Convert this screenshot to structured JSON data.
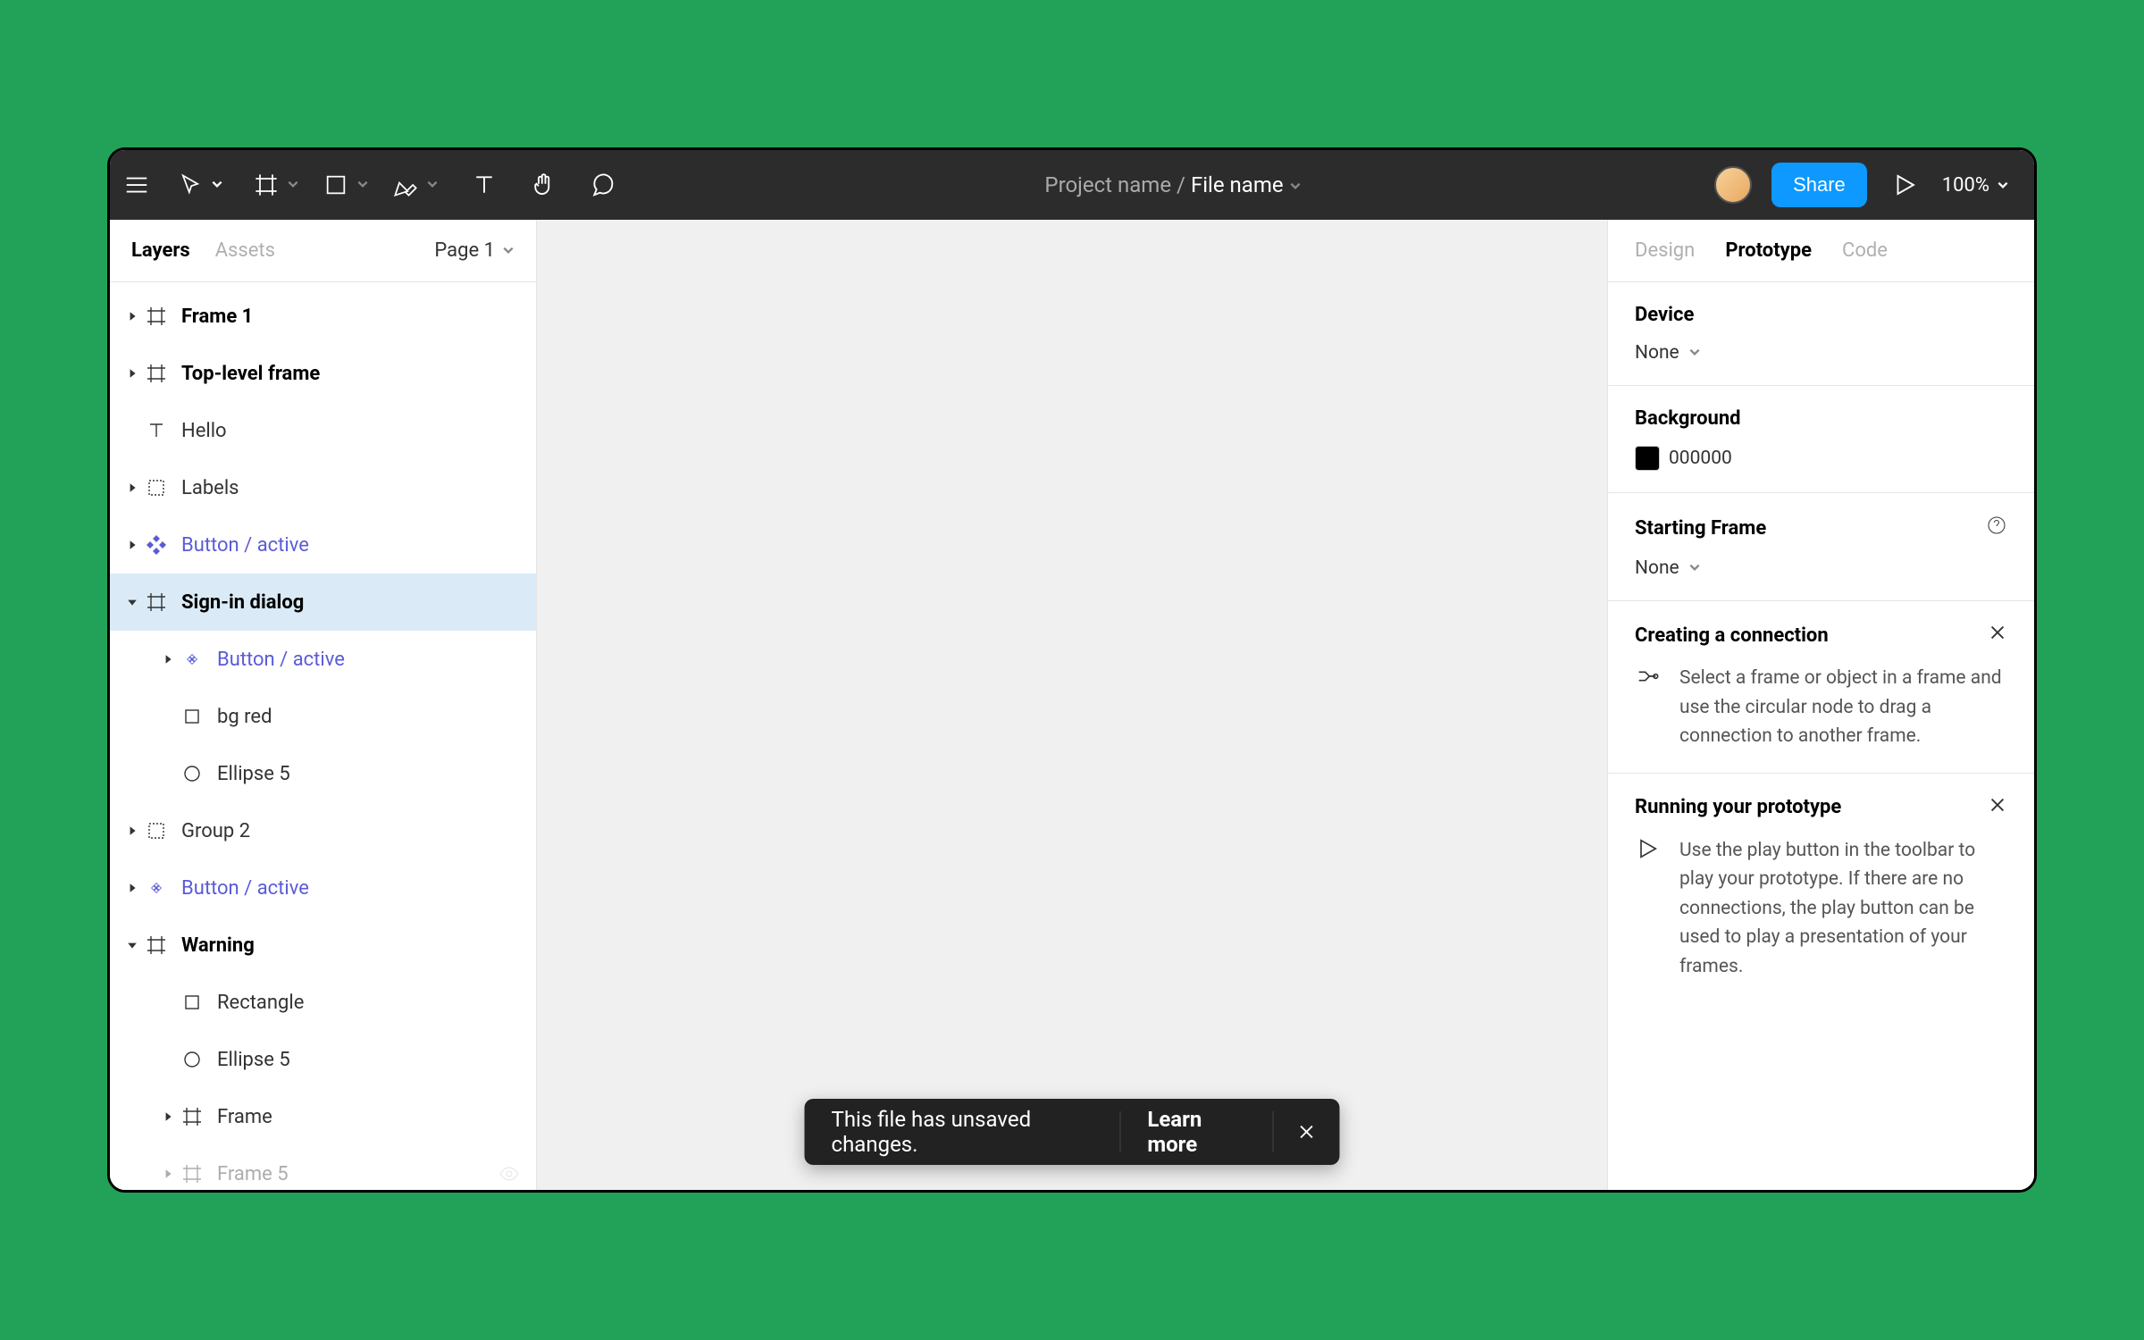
{
  "toolbar": {
    "project_name": "Project name",
    "file_name": "File name",
    "share_label": "Share",
    "zoom": "100%"
  },
  "left_panel": {
    "tabs": {
      "layers": "Layers",
      "assets": "Assets"
    },
    "page": "Page 1",
    "layers": [
      {
        "label": "Frame 1",
        "icon": "frame",
        "bold": true,
        "indent": 0,
        "disclose": "right"
      },
      {
        "label": "Top-level frame",
        "icon": "frame",
        "bold": true,
        "indent": 0,
        "disclose": "right"
      },
      {
        "label": "Hello",
        "icon": "text",
        "indent": 0
      },
      {
        "label": "Labels",
        "icon": "group",
        "indent": 0,
        "disclose": "right"
      },
      {
        "label": "Button / active",
        "icon": "component-filled",
        "purple": true,
        "indent": 0,
        "disclose": "right"
      },
      {
        "label": "Sign-in dialog",
        "icon": "frame",
        "bold": true,
        "indent": 0,
        "disclose": "down",
        "selected": true
      },
      {
        "label": "Button / active",
        "icon": "component",
        "purple": true,
        "indent": 1,
        "disclose": "right"
      },
      {
        "label": "bg red",
        "icon": "rect",
        "indent": 1
      },
      {
        "label": "Ellipse 5",
        "icon": "ellipse",
        "indent": 1
      },
      {
        "label": "Group 2",
        "icon": "group",
        "indent": 0,
        "disclose": "right"
      },
      {
        "label": "Button / active",
        "icon": "component",
        "purple": true,
        "indent": 0,
        "disclose": "right"
      },
      {
        "label": "Warning",
        "icon": "frame",
        "bold": true,
        "indent": 0,
        "disclose": "down"
      },
      {
        "label": "Rectangle",
        "icon": "rect",
        "indent": 1
      },
      {
        "label": "Ellipse 5",
        "icon": "ellipse",
        "indent": 1
      },
      {
        "label": "Frame",
        "icon": "frame",
        "indent": 1,
        "disclose": "right"
      },
      {
        "label": "Frame 5",
        "icon": "frame",
        "indent": 1,
        "disclose": "right",
        "faded": true,
        "eye": true
      }
    ]
  },
  "right_panel": {
    "tabs": {
      "design": "Design",
      "prototype": "Prototype",
      "code": "Code"
    },
    "device": {
      "title": "Device",
      "value": "None"
    },
    "background": {
      "title": "Background",
      "value": "000000",
      "color": "#000000"
    },
    "starting_frame": {
      "title": "Starting Frame",
      "value": "None"
    },
    "help_connection": {
      "title": "Creating a connection",
      "text": "Select a frame or object in a frame and use the circular node to drag a connection to another frame."
    },
    "help_running": {
      "title": "Running your prototype",
      "text": "Use the play button in the toolbar to play your prototype. If there are no connections, the play button can be used to play a presentation of your frames."
    }
  },
  "toast": {
    "message": "This file has unsaved changes.",
    "action": "Learn more"
  }
}
